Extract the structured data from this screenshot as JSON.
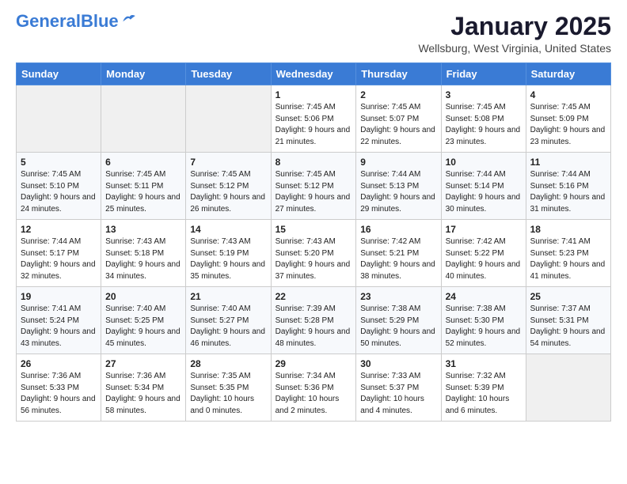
{
  "header": {
    "logo_general": "General",
    "logo_blue": "Blue",
    "month_title": "January 2025",
    "location": "Wellsburg, West Virginia, United States"
  },
  "days_of_week": [
    "Sunday",
    "Monday",
    "Tuesday",
    "Wednesday",
    "Thursday",
    "Friday",
    "Saturday"
  ],
  "weeks": [
    [
      {
        "num": "",
        "info": ""
      },
      {
        "num": "",
        "info": ""
      },
      {
        "num": "",
        "info": ""
      },
      {
        "num": "1",
        "info": "Sunrise: 7:45 AM\nSunset: 5:06 PM\nDaylight: 9 hours and 21 minutes."
      },
      {
        "num": "2",
        "info": "Sunrise: 7:45 AM\nSunset: 5:07 PM\nDaylight: 9 hours and 22 minutes."
      },
      {
        "num": "3",
        "info": "Sunrise: 7:45 AM\nSunset: 5:08 PM\nDaylight: 9 hours and 23 minutes."
      },
      {
        "num": "4",
        "info": "Sunrise: 7:45 AM\nSunset: 5:09 PM\nDaylight: 9 hours and 23 minutes."
      }
    ],
    [
      {
        "num": "5",
        "info": "Sunrise: 7:45 AM\nSunset: 5:10 PM\nDaylight: 9 hours and 24 minutes."
      },
      {
        "num": "6",
        "info": "Sunrise: 7:45 AM\nSunset: 5:11 PM\nDaylight: 9 hours and 25 minutes."
      },
      {
        "num": "7",
        "info": "Sunrise: 7:45 AM\nSunset: 5:12 PM\nDaylight: 9 hours and 26 minutes."
      },
      {
        "num": "8",
        "info": "Sunrise: 7:45 AM\nSunset: 5:12 PM\nDaylight: 9 hours and 27 minutes."
      },
      {
        "num": "9",
        "info": "Sunrise: 7:44 AM\nSunset: 5:13 PM\nDaylight: 9 hours and 29 minutes."
      },
      {
        "num": "10",
        "info": "Sunrise: 7:44 AM\nSunset: 5:14 PM\nDaylight: 9 hours and 30 minutes."
      },
      {
        "num": "11",
        "info": "Sunrise: 7:44 AM\nSunset: 5:16 PM\nDaylight: 9 hours and 31 minutes."
      }
    ],
    [
      {
        "num": "12",
        "info": "Sunrise: 7:44 AM\nSunset: 5:17 PM\nDaylight: 9 hours and 32 minutes."
      },
      {
        "num": "13",
        "info": "Sunrise: 7:43 AM\nSunset: 5:18 PM\nDaylight: 9 hours and 34 minutes."
      },
      {
        "num": "14",
        "info": "Sunrise: 7:43 AM\nSunset: 5:19 PM\nDaylight: 9 hours and 35 minutes."
      },
      {
        "num": "15",
        "info": "Sunrise: 7:43 AM\nSunset: 5:20 PM\nDaylight: 9 hours and 37 minutes."
      },
      {
        "num": "16",
        "info": "Sunrise: 7:42 AM\nSunset: 5:21 PM\nDaylight: 9 hours and 38 minutes."
      },
      {
        "num": "17",
        "info": "Sunrise: 7:42 AM\nSunset: 5:22 PM\nDaylight: 9 hours and 40 minutes."
      },
      {
        "num": "18",
        "info": "Sunrise: 7:41 AM\nSunset: 5:23 PM\nDaylight: 9 hours and 41 minutes."
      }
    ],
    [
      {
        "num": "19",
        "info": "Sunrise: 7:41 AM\nSunset: 5:24 PM\nDaylight: 9 hours and 43 minutes."
      },
      {
        "num": "20",
        "info": "Sunrise: 7:40 AM\nSunset: 5:25 PM\nDaylight: 9 hours and 45 minutes."
      },
      {
        "num": "21",
        "info": "Sunrise: 7:40 AM\nSunset: 5:27 PM\nDaylight: 9 hours and 46 minutes."
      },
      {
        "num": "22",
        "info": "Sunrise: 7:39 AM\nSunset: 5:28 PM\nDaylight: 9 hours and 48 minutes."
      },
      {
        "num": "23",
        "info": "Sunrise: 7:38 AM\nSunset: 5:29 PM\nDaylight: 9 hours and 50 minutes."
      },
      {
        "num": "24",
        "info": "Sunrise: 7:38 AM\nSunset: 5:30 PM\nDaylight: 9 hours and 52 minutes."
      },
      {
        "num": "25",
        "info": "Sunrise: 7:37 AM\nSunset: 5:31 PM\nDaylight: 9 hours and 54 minutes."
      }
    ],
    [
      {
        "num": "26",
        "info": "Sunrise: 7:36 AM\nSunset: 5:33 PM\nDaylight: 9 hours and 56 minutes."
      },
      {
        "num": "27",
        "info": "Sunrise: 7:36 AM\nSunset: 5:34 PM\nDaylight: 9 hours and 58 minutes."
      },
      {
        "num": "28",
        "info": "Sunrise: 7:35 AM\nSunset: 5:35 PM\nDaylight: 10 hours and 0 minutes."
      },
      {
        "num": "29",
        "info": "Sunrise: 7:34 AM\nSunset: 5:36 PM\nDaylight: 10 hours and 2 minutes."
      },
      {
        "num": "30",
        "info": "Sunrise: 7:33 AM\nSunset: 5:37 PM\nDaylight: 10 hours and 4 minutes."
      },
      {
        "num": "31",
        "info": "Sunrise: 7:32 AM\nSunset: 5:39 PM\nDaylight: 10 hours and 6 minutes."
      },
      {
        "num": "",
        "info": ""
      }
    ]
  ]
}
